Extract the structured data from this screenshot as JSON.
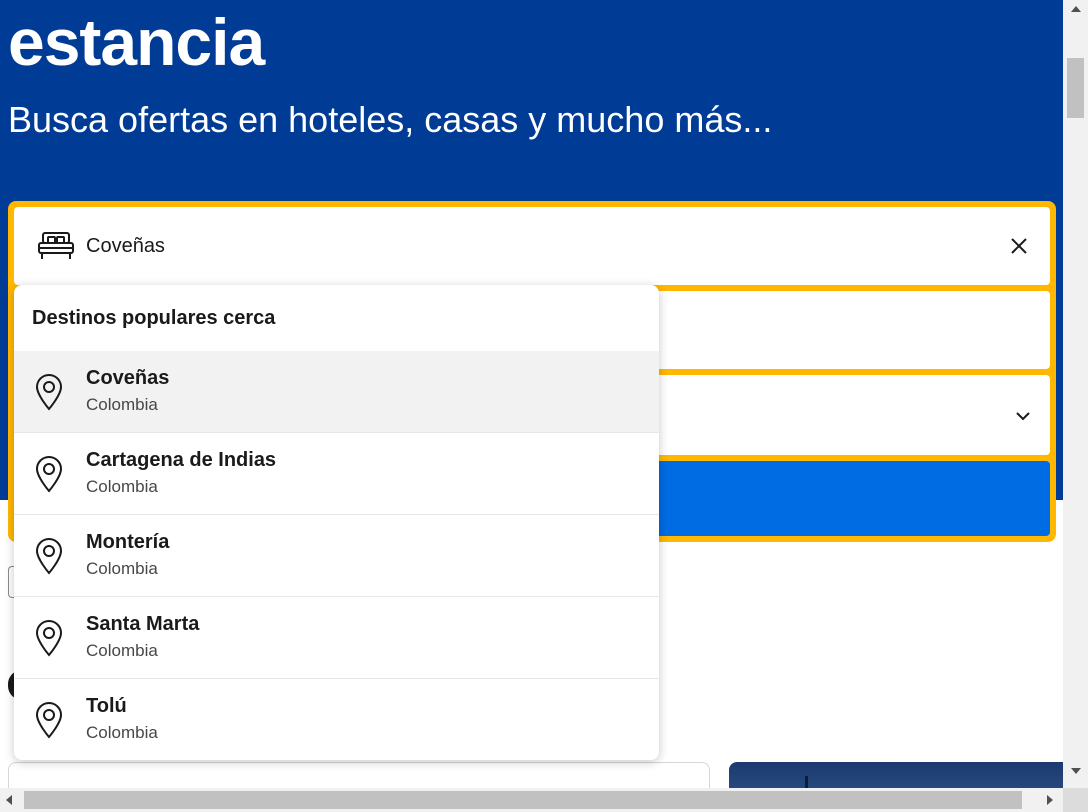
{
  "hero": {
    "title": "estancia",
    "subtitle": "Busca ofertas en hoteles, casas y mucho más..."
  },
  "search": {
    "destination_value": "Coveñas",
    "bed_icon": "bed-icon",
    "clear_icon": "close-icon",
    "chevron_icon": "chevron-down-icon"
  },
  "dropdown": {
    "heading": "Destinos populares cerca",
    "items": [
      {
        "name": "Coveñas",
        "country": "Colombia",
        "icon": "map-pin-icon",
        "highlighted": true
      },
      {
        "name": "Cartagena de Indias",
        "country": "Colombia",
        "icon": "map-pin-icon"
      },
      {
        "name": "Montería",
        "country": "Colombia",
        "icon": "map-pin-icon"
      },
      {
        "name": "Santa Marta",
        "country": "Colombia",
        "icon": "map-pin-icon"
      },
      {
        "name": "Tolú",
        "country": "Colombia",
        "icon": "map-pin-icon"
      }
    ]
  },
  "colors": {
    "hero_bg": "#003b95",
    "search_border": "#ffb700",
    "search_button": "#006ce4",
    "highlight_row": "#f2f2f2"
  }
}
